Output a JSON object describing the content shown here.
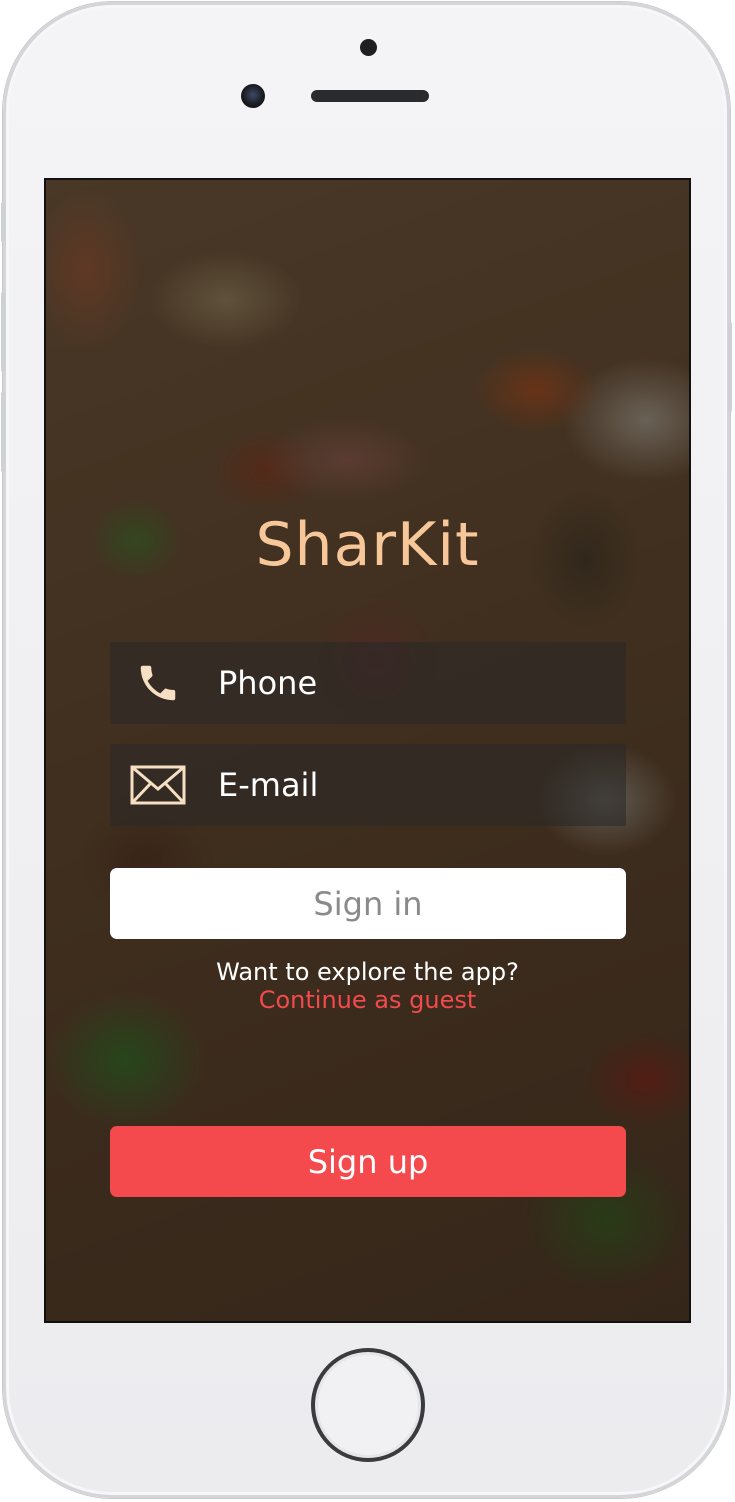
{
  "app": {
    "name": "SharKit"
  },
  "login": {
    "phone_placeholder": "Phone",
    "email_placeholder": "E-mail",
    "signin_label": "Sign in",
    "explore_question": "Want to explore the app?",
    "guest_link": "Continue as guest",
    "signup_label": "Sign up"
  },
  "icons": {
    "phone": "phone-icon",
    "email": "envelope-icon"
  },
  "colors": {
    "brand_text": "#f7c79a",
    "accent": "#f54a4d",
    "guest_link": "#f24a4d",
    "signin_text": "#8a8a8a"
  }
}
